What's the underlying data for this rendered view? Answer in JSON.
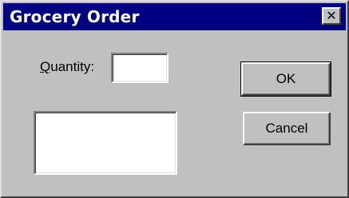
{
  "window": {
    "title": "Grocery Order",
    "close_glyph": "✕"
  },
  "form": {
    "quantity_label_mnemonic": "Q",
    "quantity_label_rest": "uantity:",
    "quantity_value": "",
    "notes_value": ""
  },
  "buttons": {
    "ok_label": "OK",
    "cancel_label": "Cancel"
  },
  "colors": {
    "titlebar": "#000080",
    "face": "#c0c0c0",
    "field": "#ffffff"
  }
}
